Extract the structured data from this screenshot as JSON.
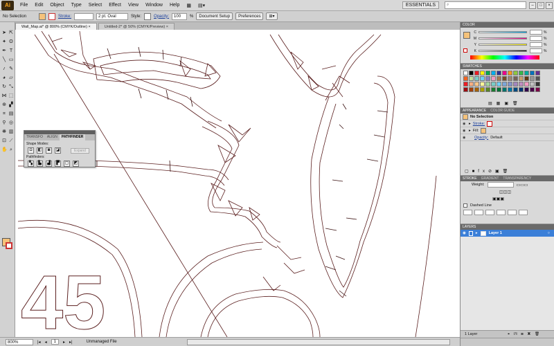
{
  "app": {
    "logo": "Ai",
    "menus": [
      "File",
      "Edit",
      "Object",
      "Type",
      "Select",
      "Effect",
      "View",
      "Window",
      "Help"
    ],
    "workspace": "ESSENTIALS"
  },
  "control_bar": {
    "selection": "No Selection",
    "stroke_label": "Stroke:",
    "brush_value": "2 pt. Oval",
    "style_label": "Style:",
    "opacity_label": "Opacity:",
    "opacity_value": "100",
    "percent": "%",
    "document_setup": "Document Setup",
    "preferences": "Preferences"
  },
  "tabs": [
    {
      "label": "Wall_Map.ai* @ 800% (CMYK/Outline)"
    },
    {
      "label": "Untitled-2* @ 50% (CMYK/Preview)"
    }
  ],
  "status_bar": {
    "zoom": "800%",
    "page": "1",
    "file_status": "Unmanaged File"
  },
  "pathfinder_panel": {
    "tabs": [
      "TRANSFO",
      "ALIGN",
      "PATHFINDER"
    ],
    "shape_modes_label": "Shape Modes:",
    "pathfinders_label": "Pathfinders:",
    "expand_label": "Expand"
  },
  "color_panel": {
    "title": "COLOR",
    "channels": [
      {
        "label": "C",
        "gradient": "#00aeef"
      },
      {
        "label": "M",
        "gradient": "#ec008c"
      },
      {
        "label": "Y",
        "gradient": "#fff200"
      },
      {
        "label": "K",
        "gradient": "#000000"
      }
    ],
    "percent": "%"
  },
  "swatches_panel": {
    "title": "SWATCHES",
    "colors": [
      "#ffffff",
      "#000000",
      "#ed1c24",
      "#fff200",
      "#00a651",
      "#00aeef",
      "#2e3192",
      "#ec008c",
      "#f7941d",
      "#8dc63f",
      "#39b54a",
      "#00a99d",
      "#0072bc",
      "#662d91",
      "#f26522",
      "#c4df9b",
      "#7accc8",
      "#6dcff6",
      "#8781bd",
      "#f49ac1",
      "#a67c52",
      "#754c24",
      "#998675",
      "#736357",
      "#c69c6d",
      "#603913",
      "#959595",
      "#555555",
      "#ee1d24",
      "#f9ad81",
      "#fdc689",
      "#fff799",
      "#a3d39c",
      "#7bcdc8",
      "#6ecff6",
      "#7da7d9",
      "#8393ca",
      "#a187be",
      "#bd8cbf",
      "#f49ac2",
      "#c2c2c2",
      "#363636",
      "#9e0b0f",
      "#a0410d",
      "#a36209",
      "#aba000",
      "#598527",
      "#1a7b30",
      "#007236",
      "#00746b",
      "#0076a3",
      "#004a80",
      "#003471",
      "#32004b",
      "#4b0049",
      "#7b0046"
    ],
    "title_inactive": ""
  },
  "appearance_panel": {
    "title": "APPEARANCE",
    "tab_inactive": "COLOR GUIDE",
    "selection": "No Selection",
    "stroke_label": "Stroke:",
    "fill_label": "Fill:",
    "opacity_label": "Opacity:",
    "opacity_value": "Default"
  },
  "stroke_panel": {
    "title": "STROKE",
    "tabs_inactive": [
      "GRADIENT",
      "TRANSPARENCY"
    ],
    "weight_label": "Weight:",
    "dashed_label": "Dashed Line"
  },
  "layers_panel": {
    "title": "LAYERS",
    "layer_name": "Layer 1",
    "footer": "1 Layer"
  },
  "canvas": {
    "number_text": "45"
  }
}
